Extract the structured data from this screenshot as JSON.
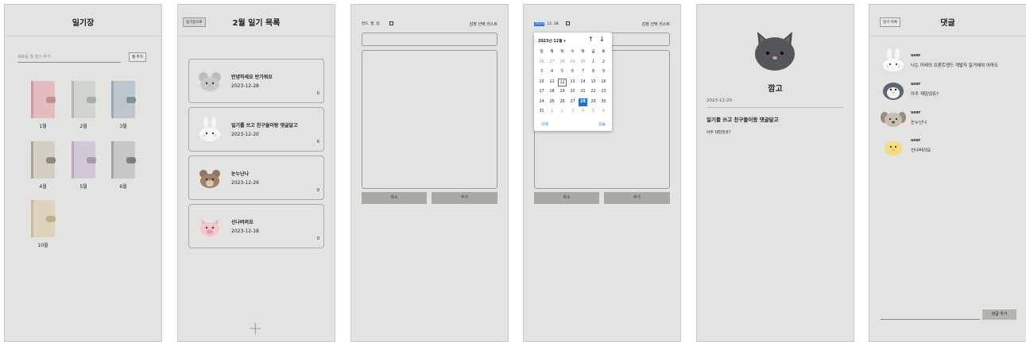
{
  "panel1": {
    "title": "일기장",
    "input_placeholder": "새로운 월 일기 추가",
    "add_button": "월 추가",
    "books": [
      {
        "label": "1월",
        "color": "#e3bcc0",
        "spine": "#cd9aa0",
        "clasp": "#c08e93"
      },
      {
        "label": "2월",
        "color": "#cfd4cc",
        "spine": "#b2b9ae",
        "clasp": "#a6ada2"
      },
      {
        "label": "3월",
        "color": "#bcc6cc",
        "spine": "#9aa8b0",
        "clasp": "#7f8d96"
      },
      {
        "label": "4월",
        "color": "#d3cfc6",
        "spine": "#aaa496",
        "clasp": "#8f897b"
      },
      {
        "label": "5월",
        "color": "#d2c9d6",
        "spine": "#b9abbf",
        "clasp": "#a898b0"
      },
      {
        "label": "6월",
        "color": "#c6c8c9",
        "spine": "#9ea1a3",
        "clasp": "#7b7e80"
      },
      {
        "label": "10월",
        "color": "#dfd3bd",
        "spine": "#c9b99a",
        "clasp": "#c2b08d"
      }
    ]
  },
  "panel2": {
    "back_button": "일기장으로",
    "title": "2월 일기 목록",
    "entries": [
      {
        "title": "안녕하세요 반가워요",
        "date": "2023-12-28",
        "count": "0",
        "avatar": "mouse"
      },
      {
        "title": "일기를 쓰고 친구들이랑 댓글달고",
        "date": "2023-12-20",
        "count": "0",
        "avatar": "rabbit"
      },
      {
        "title": "눈누난나",
        "date": "2023-12-26",
        "count": "0",
        "avatar": "bear"
      },
      {
        "title": "신나버려요",
        "date": "2023-12-18",
        "count": "0",
        "avatar": "pig"
      }
    ],
    "add_icon": "+"
  },
  "panel3": {
    "date_placeholder": "연도. 월. 일.",
    "emotion_list": "감정 선택 리스트",
    "cancel_button": "취소",
    "add_button": "추가"
  },
  "panel4": {
    "date_value_year": "2023",
    "date_value_rest": ". 12. 28.",
    "emotion_list": "감정 선택 리스트",
    "cancel_button": "취소",
    "add_button": "추가",
    "calendar": {
      "month_label": "2023년 12월 ▾",
      "weekdays": [
        "일",
        "월",
        "화",
        "수",
        "목",
        "금",
        "토"
      ],
      "weeks": [
        [
          "26",
          "27",
          "28",
          "29",
          "30",
          "1",
          "2"
        ],
        [
          "3",
          "4",
          "5",
          "6",
          "7",
          "8",
          "9"
        ],
        [
          "10",
          "11",
          "12",
          "13",
          "14",
          "15",
          "16"
        ],
        [
          "17",
          "18",
          "19",
          "20",
          "21",
          "22",
          "23"
        ],
        [
          "24",
          "25",
          "26",
          "27",
          "28",
          "29",
          "30"
        ],
        [
          "31",
          "1",
          "2",
          "3",
          "4",
          "5",
          "6"
        ]
      ],
      "selected": "28",
      "today": "12",
      "clear_button": "삭제",
      "today_button": "오늘"
    }
  },
  "panel5": {
    "name": "깜고",
    "date": "2023-12-20",
    "title": "일기를 쓰고 친구들이랑 댓글달고",
    "content": "아주 재밌었쥬?"
  },
  "panel6": {
    "back_button": "일기 목록",
    "title": "댓글",
    "comments": [
      {
        "user": "user",
        "text": "나는 미래의 프론트엔드 개발자 일거에여 아마도",
        "avatar": "rabbit"
      },
      {
        "user": "user",
        "text": "아주 재밌었쥬?",
        "avatar": "penguin"
      },
      {
        "user": "user",
        "text": "눈누난나",
        "avatar": "dog"
      },
      {
        "user": "user",
        "text": "신나버려요",
        "avatar": "chick"
      }
    ],
    "add_comment_button": "댓글 추가"
  }
}
